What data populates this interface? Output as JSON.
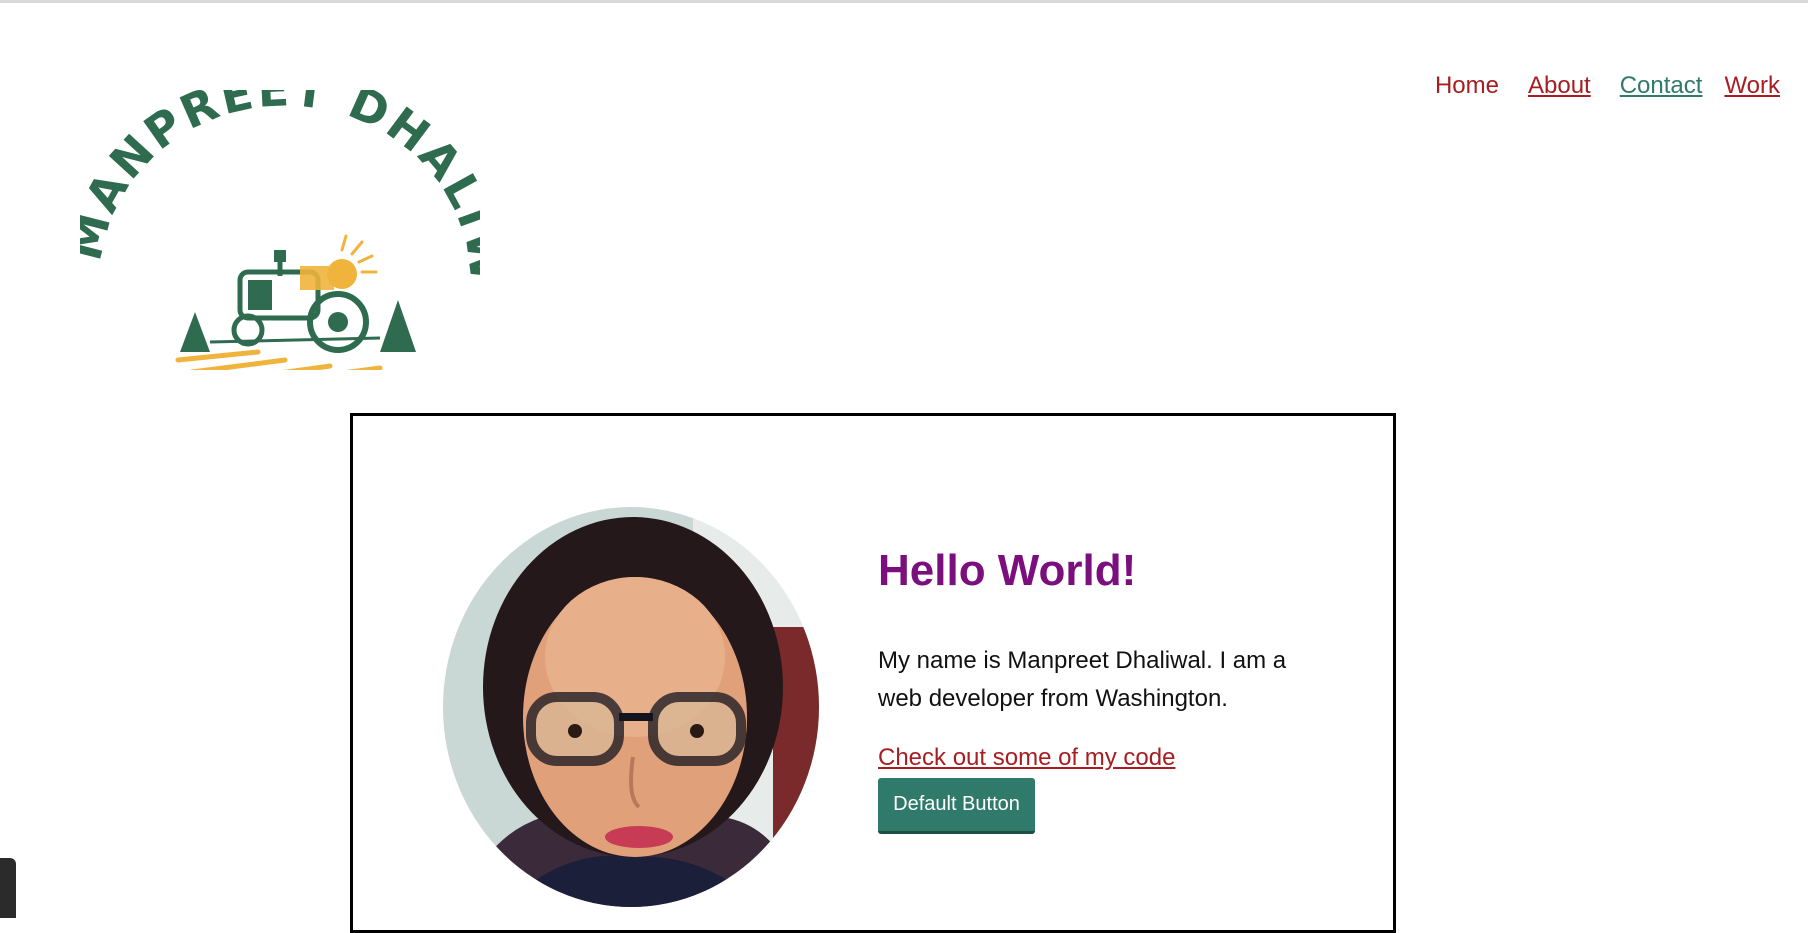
{
  "logo": {
    "text": "MANPREET DHALIWAL",
    "icon": "tractor-logo-icon",
    "colors": {
      "green": "#2e6b4f",
      "gold": "#f0b43c"
    }
  },
  "nav": {
    "home": "Home",
    "about": "About",
    "contact": "Contact",
    "work": "Work"
  },
  "hero": {
    "heading": "Hello World!",
    "bio": "My name is Manpreet Dhaliwal. I am a web developer from Washington.",
    "code_link": "Check out some of my code",
    "button_label": "Default Button",
    "avatar_icon": "profile-photo"
  },
  "colors": {
    "link": "#a61e22",
    "link_visited": "#2f7a6a",
    "heading": "#7b0f7e",
    "button": "#2f7a6a"
  }
}
